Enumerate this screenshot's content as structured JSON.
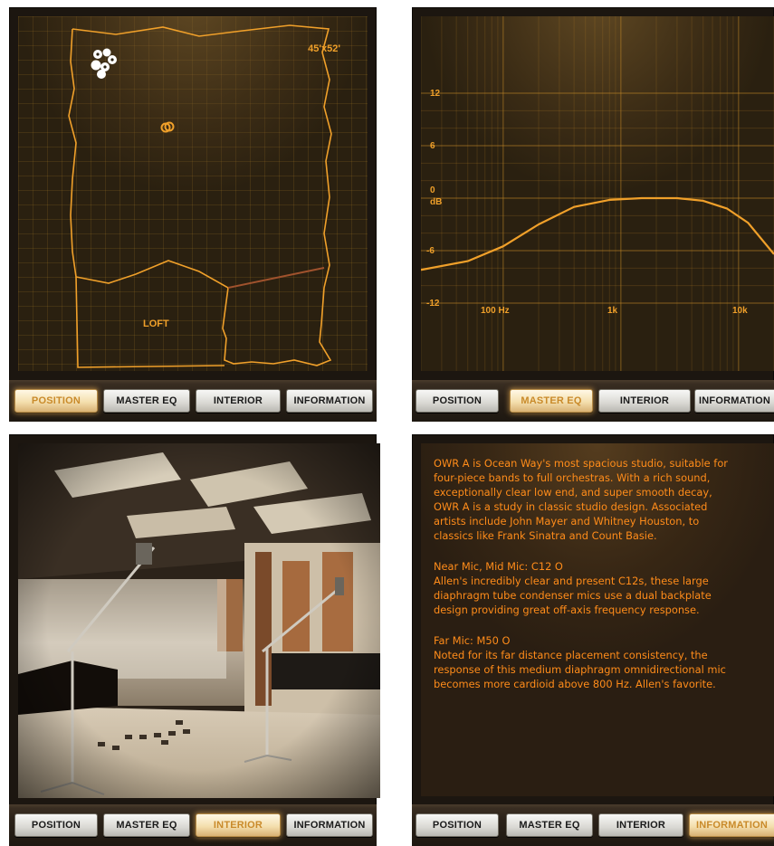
{
  "tabs": [
    "POSITION",
    "MASTER EQ",
    "INTERIOR",
    "INFORMATION"
  ],
  "panels": {
    "position": {
      "active_tab": "POSITION",
      "room_size": "45'x52'",
      "region_label": "LOFT"
    },
    "master_eq": {
      "active_tab": "MASTER EQ",
      "y_ticks": [
        "12",
        "6",
        "0",
        "-6",
        "-12"
      ],
      "y_unit": "dB",
      "x_ticks": [
        "100 Hz",
        "1k",
        "10k"
      ],
      "chart_data": {
        "type": "line",
        "xlabel": "",
        "ylabel": "dB",
        "ylim": [
          -12,
          12
        ],
        "x_scale": "log",
        "series": [
          {
            "x": [
              20,
              50,
              100,
              200,
              400,
              800,
              1500,
              3000,
              5000,
              8000,
              12000,
              20000
            ],
            "values": [
              -8.2,
              -7.2,
              -5.5,
              -3.0,
              -1.0,
              -0.2,
              0,
              0,
              -0.3,
              -1.2,
              -2.8,
              -6.4
            ]
          }
        ]
      }
    },
    "interior": {
      "active_tab": "INTERIOR"
    },
    "information": {
      "active_tab": "INFORMATION",
      "paragraphs": [
        {
          "lines": [
            "OWR A is Ocean Way's most spacious studio, suitable for",
            "four-piece bands to full orchestras. With a rich sound,",
            "exceptionally clear low end, and super smooth decay,",
            "OWR A is a study in classic studio design. Associated",
            "artists include John Mayer and Whitney Houston, to",
            "classics like Frank Sinatra and Count Basie."
          ]
        },
        {
          "lines": [
            "Near Mic, Mid Mic: C12 O",
            "Allen's incredibly clear and present C12s, these large",
            "diaphragm tube condenser mics use a dual backplate",
            "design providing great off-axis frequency response."
          ]
        },
        {
          "lines": [
            "Far Mic: M50 O",
            "Noted for its far distance placement consistency, the",
            "response of this medium diaphragm omnidirectional mic",
            "becomes more cardioid above 800 Hz. Allen's favorite."
          ]
        }
      ]
    }
  },
  "colors": {
    "accent": "#f0a02a",
    "text_orange": "#ff8c1a",
    "panel_bg": "#1c1610"
  }
}
